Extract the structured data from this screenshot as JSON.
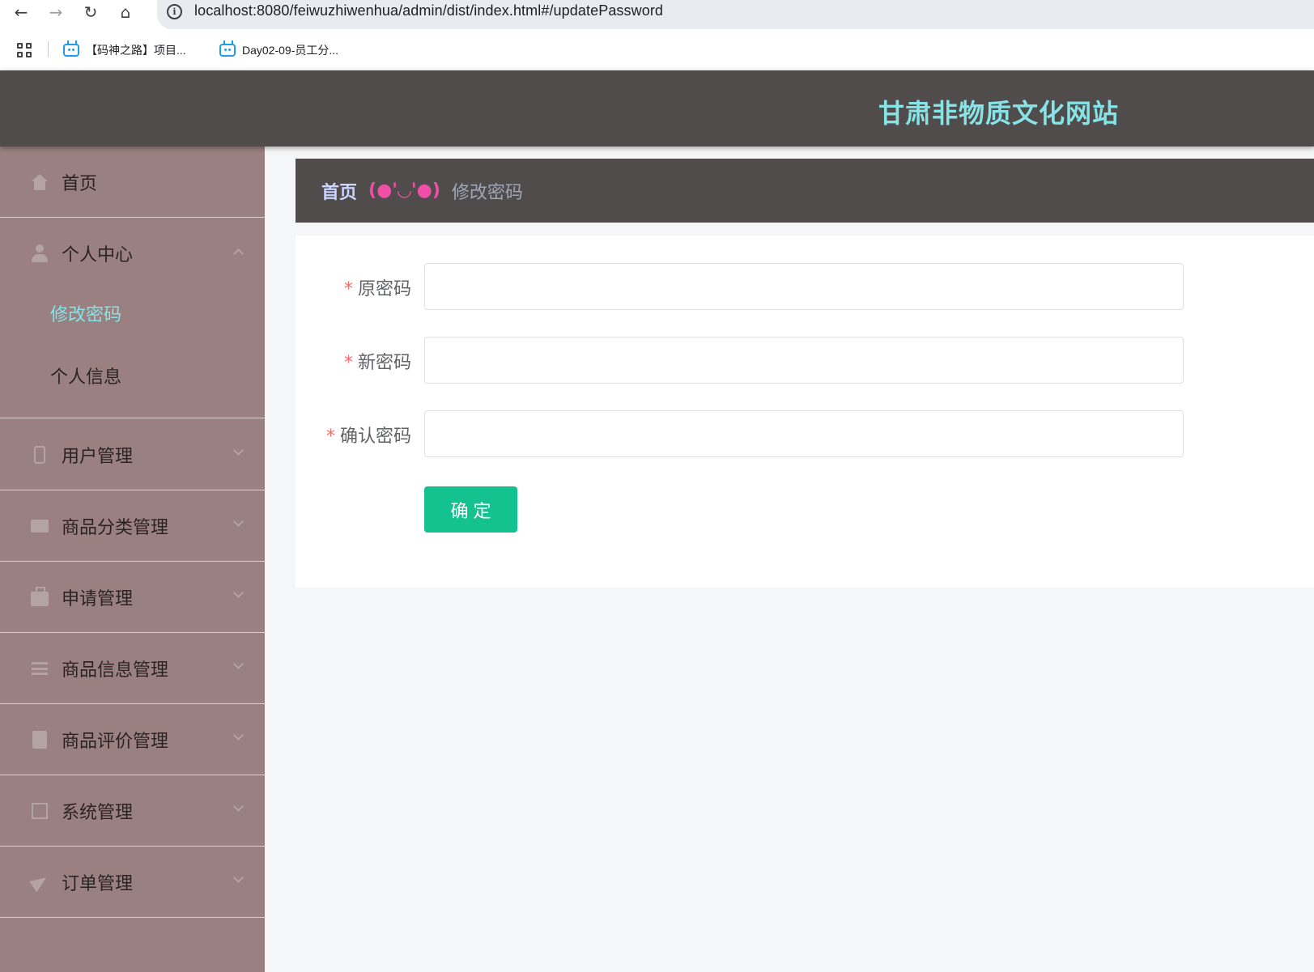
{
  "browser": {
    "url": "localhost:8080/feiwuzhiwenhua/admin/dist/index.html#/updatePassword",
    "bookmarks": [
      {
        "label": "【码神之路】项目..."
      },
      {
        "label": "Day02-09-员工分..."
      }
    ]
  },
  "header": {
    "title": "甘肃非物质文化网站",
    "title_color": "#86e3e6",
    "bg_color": "#514c4c"
  },
  "sidebar": {
    "bg_color": "#9a8080",
    "items": [
      {
        "label": "首页",
        "icon": "home-icon"
      },
      {
        "label": "个人中心",
        "icon": "user-icon",
        "expanded": true,
        "children": [
          {
            "label": "修改密码",
            "active": true
          },
          {
            "label": "个人信息"
          }
        ]
      },
      {
        "label": "用户管理",
        "icon": "phone-icon"
      },
      {
        "label": "商品分类管理",
        "icon": "ticket-icon"
      },
      {
        "label": "申请管理",
        "icon": "briefcase-icon"
      },
      {
        "label": "商品信息管理",
        "icon": "list-icon"
      },
      {
        "label": "商品评价管理",
        "icon": "clipboard-icon"
      },
      {
        "label": "系统管理",
        "icon": "crop-icon"
      },
      {
        "label": "订单管理",
        "icon": "send-icon"
      }
    ]
  },
  "breadcrumb": {
    "home": "首页",
    "separator": "(●'◡'●)",
    "current": "修改密码"
  },
  "form": {
    "fields": [
      {
        "label": "原密码",
        "required": true,
        "value": ""
      },
      {
        "label": "新密码",
        "required": true,
        "value": ""
      },
      {
        "label": "确认密码",
        "required": true,
        "value": ""
      }
    ],
    "required_mark": "*",
    "submit_label": "确定",
    "submit_color": "#13c28e"
  }
}
